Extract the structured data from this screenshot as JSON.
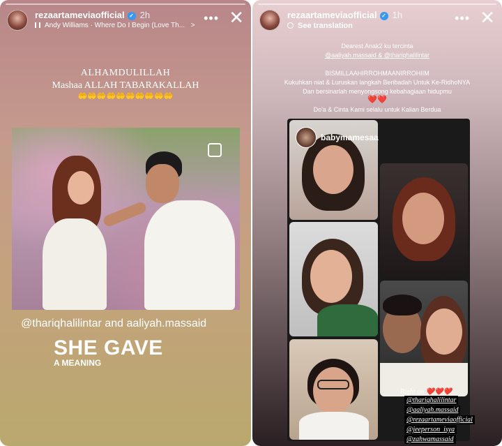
{
  "left_story": {
    "username": "rezaartameviaofficial",
    "time": "2h",
    "music_icon": "music-bars-icon",
    "music_text": "Andy Williams · Where Do I Begin (Love Th...",
    "chevron": ">",
    "more": "•••",
    "close": "✕",
    "text_line1": "ALHAMDULILLAH",
    "text_line2": "Mashaa ALLAH TABARAKALLAH",
    "emoji_line": "🤲🤲🤲🤲🤲🤲🤲🤲🤲🤲",
    "mention_caption": "@thariqhalilintar and aaliyah.massaid",
    "headline": "SHE GAVE",
    "subheadline": "A MEANING"
  },
  "right_story": {
    "username": "rezaartameviaofficial",
    "time": "1h",
    "translate": "See translation",
    "more": "•••",
    "close": "✕",
    "line1": "Dearest Anak2 ku tercinta",
    "line2": "@aaliyah.massaid & @thariqhalilintar",
    "line3": "BISMILLAAHIRROHMAANIRROHIIM",
    "line4": "Kukuhkan niat & Luruskan langkah Beribadah Untuk Ke-RidhoNYA",
    "line5": "Dan bersinarlah menyongsong kebahagiaan hidupmu",
    "hearts": "❤️❤️",
    "line6": "Do'a &  Cinta Kami selalu untuk Kalian Berdua",
    "embedded_username": "babymamesaa",
    "tags_header": "Right on ❤️❤️❤️",
    "tags": [
      "@thariqhalilintar",
      "@aaliyah.massaid",
      "@rezaartameviaofficial",
      "@jeeperson_isya",
      "@zahwamassaid"
    ]
  }
}
